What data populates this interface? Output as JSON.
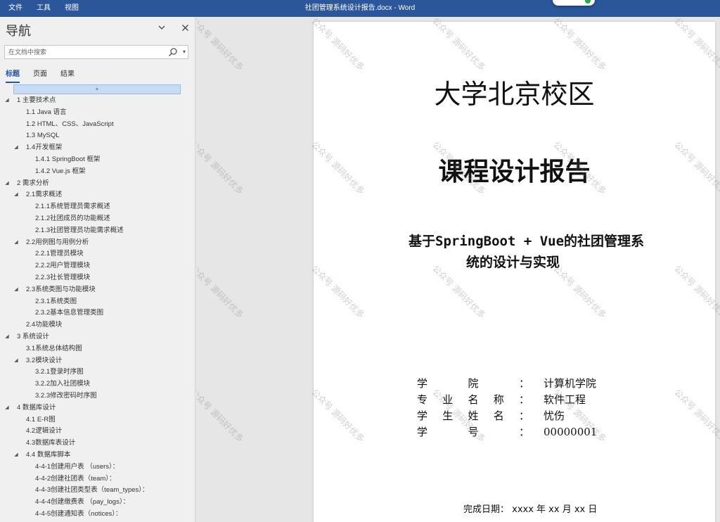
{
  "titlebar": {
    "menu": [
      "文件",
      "工具",
      "视图"
    ],
    "title": "社团管理系统设计报告.docx  -  Word"
  },
  "nav": {
    "heading": "导航",
    "search_placeholder": "在文档中搜索",
    "tabs": [
      "标题",
      "页面",
      "结果"
    ],
    "active_tab": "标题",
    "drop_marker": "+",
    "items": [
      {
        "level": 1,
        "label": "1 主要技术点",
        "expanded": true
      },
      {
        "level": 2,
        "label": "1.1 Java 语言"
      },
      {
        "level": 2,
        "label": "1.2 HTML、CSS、JavaScript"
      },
      {
        "level": 2,
        "label": "1.3 MySQL"
      },
      {
        "level": 2,
        "label": "1.4开发框架",
        "expanded": true
      },
      {
        "level": 3,
        "label": "1.4.1 SpringBoot 框架"
      },
      {
        "level": 3,
        "label": "1.4.2 Vue.js 框架"
      },
      {
        "level": 1,
        "label": "2 需求分析",
        "expanded": true
      },
      {
        "level": 2,
        "label": "2.1需求概述",
        "expanded": true
      },
      {
        "level": 3,
        "label": "2.1.1系统管理员需求概述"
      },
      {
        "level": 3,
        "label": "2.1.2社团成员的功能概述"
      },
      {
        "level": 3,
        "label": "2.1.3社团管理员功能需求概述"
      },
      {
        "level": 2,
        "label": "2.2用例图与用例分析",
        "expanded": true
      },
      {
        "level": 3,
        "label": "2.2.1管理员模块"
      },
      {
        "level": 3,
        "label": "2.2.2用户管理模块"
      },
      {
        "level": 3,
        "label": "2.2.3社长管理模块"
      },
      {
        "level": 2,
        "label": "2.3系统类图与功能模块",
        "expanded": true
      },
      {
        "level": 3,
        "label": "2.3.1系统类图"
      },
      {
        "level": 3,
        "label": "2.3.2基本信息管理类图"
      },
      {
        "level": 2,
        "label": "2.4功能模块"
      },
      {
        "level": 1,
        "label": "3 系统设计",
        "expanded": true
      },
      {
        "level": 2,
        "label": "3.1系统总体结构图"
      },
      {
        "level": 2,
        "label": "3.2模块设计",
        "expanded": true
      },
      {
        "level": 3,
        "label": "3.2.1登录时序图"
      },
      {
        "level": 3,
        "label": "3.2.2加入社团模块"
      },
      {
        "level": 3,
        "label": "3.2.3修改密码时序图"
      },
      {
        "level": 1,
        "label": "4 数据库设计",
        "expanded": true
      },
      {
        "level": 2,
        "label": "4.1 E-R图"
      },
      {
        "level": 2,
        "label": "4.2逻辑设计"
      },
      {
        "level": 2,
        "label": "4.3数据库表设计"
      },
      {
        "level": 2,
        "label": "4.4 数据库脚本",
        "expanded": true
      },
      {
        "level": 3,
        "label": "4-4-1创建用户表 （users）："
      },
      {
        "level": 3,
        "label": "4-4-2创建社团表（team）："
      },
      {
        "level": 3,
        "label": "4-4-3创建社团类型表（team_types）："
      },
      {
        "level": 3,
        "label": "4-4-4创建缴费表 （pay_logs）："
      },
      {
        "level": 3,
        "label": "4-4-5创建通知表（notices）："
      }
    ]
  },
  "document": {
    "university": "大学北京校区",
    "report_title": "课程设计报告",
    "topic_line1": "基于SpringBoot + Vue的社团管理系",
    "topic_line2": "统的设计与实现",
    "info": [
      {
        "key_chars": [
          "学",
          "院"
        ],
        "value": "计算机学院"
      },
      {
        "key_chars": [
          "专",
          "业",
          "名",
          "称"
        ],
        "value": "软件工程"
      },
      {
        "key_chars": [
          "学",
          "生",
          "姓",
          "名"
        ],
        "value": "忧伤"
      },
      {
        "key_chars": [
          "学",
          "号"
        ],
        "value": "00000001"
      }
    ],
    "colon": "：",
    "completion_date": "完成日期： xxxx 年 xx 月 xx 日",
    "watermark_text": "公众号 源码好优多"
  },
  "colors": {
    "titlebar": "#2b579a",
    "accent": "#2b579a",
    "nav_bg": "#f0f0f0",
    "workspace_bg": "#e6e6e6"
  }
}
